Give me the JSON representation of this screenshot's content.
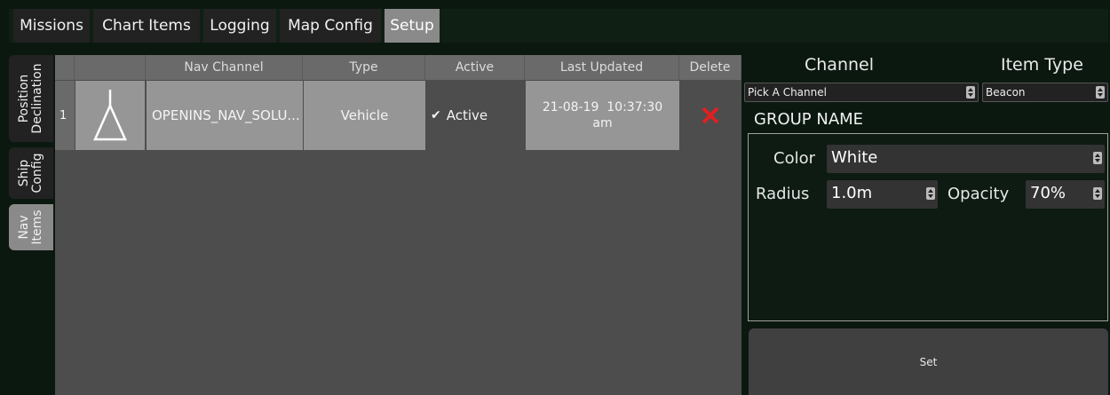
{
  "tabs": [
    "Missions",
    "Chart Items",
    "Logging",
    "Map Config",
    "Setup"
  ],
  "side_tabs": {
    "position_declination": "Position\nDeclination",
    "ship_config": "Ship\nConfig",
    "nav_items": "Nav\nItems"
  },
  "table": {
    "headers": {
      "nav_channel": "Nav Channel",
      "type": "Type",
      "active": "Active",
      "last_updated": "Last Updated",
      "delete": "Delete"
    },
    "rows": [
      {
        "index": "1",
        "icon": "triangle-beacon-icon",
        "nav_channel": "OPENINS_NAV_SOLU...",
        "type": "Vehicle",
        "active_label": "Active",
        "active_checked": true,
        "last_updated": "21-08-19  10:37:30\nam"
      }
    ]
  },
  "panel": {
    "channel_header": "Channel",
    "item_type_header": "Item Type",
    "channel_select": "Pick A Channel",
    "item_type_select": "Beacon",
    "group_name": "GROUP NAME",
    "color_label": "Color",
    "color_value": "White",
    "radius_label": "Radius",
    "radius_value": "1.0m",
    "opacity_label": "Opacity",
    "opacity_value": "70%",
    "set_button": "Set"
  },
  "colors": {
    "background": "#0b1810",
    "tab_bg": "#222222",
    "tab_active_bg": "#8a8a8a",
    "delete_icon": "#e02020"
  }
}
